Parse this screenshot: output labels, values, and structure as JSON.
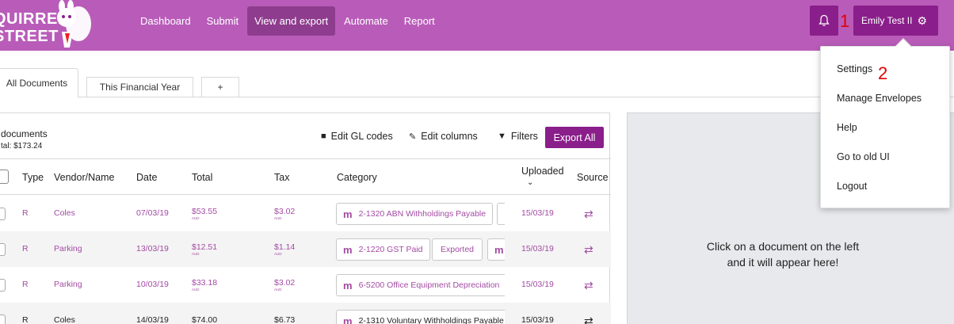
{
  "logo": {
    "line1": "QUIRREL",
    "line2": "STREET"
  },
  "nav": [
    "Dashboard",
    "Submit",
    "View and export",
    "Automate",
    "Report"
  ],
  "nav_active_index": 2,
  "user": {
    "name": "Emily Test II"
  },
  "annotations": {
    "one": "1",
    "two": "2"
  },
  "tabs": {
    "active": "All Documents",
    "second": "This Financial Year",
    "add": "+"
  },
  "summary": {
    "count": "documents",
    "total": "tal: $173.24"
  },
  "toolbar": {
    "edit_gl": "Edit GL codes",
    "edit_columns": "Edit columns",
    "filters": "Filters",
    "export_all": "Export All"
  },
  "columns": {
    "type": "Type",
    "vendor": "Vendor/Name",
    "date": "Date",
    "total": "Total",
    "tax": "Tax",
    "category": "Category",
    "uploaded": "Uploaded",
    "source": "Source"
  },
  "rows": [
    {
      "type": "R",
      "vendor": "Coles",
      "date": "07/03/19",
      "total": "$53.55",
      "total_cur": "AUD",
      "tax": "$3.02",
      "tax_cur": "AUD",
      "category": "2-1320 ABN Withholdings Payable",
      "uploaded": "15/03/19"
    },
    {
      "type": "R",
      "vendor": "Parking",
      "date": "13/03/19",
      "total": "$12.51",
      "total_cur": "AUD",
      "tax": "$1.14",
      "tax_cur": "AUD",
      "category": "2-1220 GST Paid",
      "status": "Exported",
      "uploaded": "15/03/19"
    },
    {
      "type": "R",
      "vendor": "Parking",
      "date": "10/03/19",
      "total": "$33.18",
      "total_cur": "AUD",
      "tax": "$3.02",
      "tax_cur": "AUD",
      "category": "6-5200 Office Equipment Depreciation",
      "uploaded": "15/03/19"
    },
    {
      "type": "R",
      "vendor": "Coles",
      "date": "14/03/19",
      "total": "$74.00",
      "tax": "$6.73",
      "category": "2-1310 Voluntary Withholdings Payable",
      "uploaded": "15/03/19"
    }
  ],
  "category_logo": "m",
  "preview": {
    "line1": "Click on a document on the left",
    "line2": "and it will appear here!"
  },
  "menu": [
    "Settings",
    "Manage Envelopes",
    "Help",
    "Go to old UI",
    "Logout"
  ],
  "colors": {
    "brand": "#b95cb9",
    "brand_dark": "#8a1e8a",
    "link": "#a34ba3",
    "annotation": "#e00000"
  }
}
